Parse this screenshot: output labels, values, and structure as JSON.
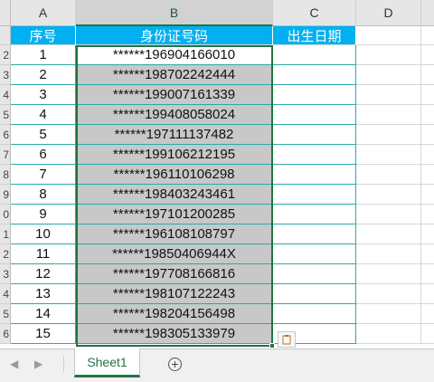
{
  "columns": [
    "A",
    "B",
    "C",
    "D"
  ],
  "row_numbers": [
    "2",
    "2",
    "3",
    "4",
    "5",
    "6",
    "7",
    "8",
    "9",
    "0",
    "1",
    "2",
    "3",
    "4",
    "5",
    "6"
  ],
  "table": {
    "headers": [
      "序号",
      "身份证号码",
      "出生日期"
    ],
    "rows": [
      {
        "no": "1",
        "id": "******196904166010"
      },
      {
        "no": "2",
        "id": "******198702242444"
      },
      {
        "no": "3",
        "id": "******199007161339"
      },
      {
        "no": "4",
        "id": "******199408058024"
      },
      {
        "no": "5",
        "id": "******197111137482"
      },
      {
        "no": "6",
        "id": "******199106212195"
      },
      {
        "no": "7",
        "id": "******196110106298"
      },
      {
        "no": "8",
        "id": "******198403243461"
      },
      {
        "no": "9",
        "id": "******197101200285"
      },
      {
        "no": "10",
        "id": "******196108108797"
      },
      {
        "no": "11",
        "id": "******19850406944X"
      },
      {
        "no": "12",
        "id": "******197708166816"
      },
      {
        "no": "13",
        "id": "******198107122243"
      },
      {
        "no": "14",
        "id": "******198204156498"
      },
      {
        "no": "15",
        "id": "******198305133979"
      }
    ]
  },
  "sheet_tab": "Sheet1",
  "add_sheet_symbol": "+",
  "nav_prev": "◀",
  "nav_next": "▶",
  "quick_analysis_icon": "paste-options-icon",
  "colors": {
    "header_fill": "#00b0f0",
    "selection_fill": "#c8c8c8",
    "accent": "#217346",
    "table_border": "#2aa9a9"
  }
}
